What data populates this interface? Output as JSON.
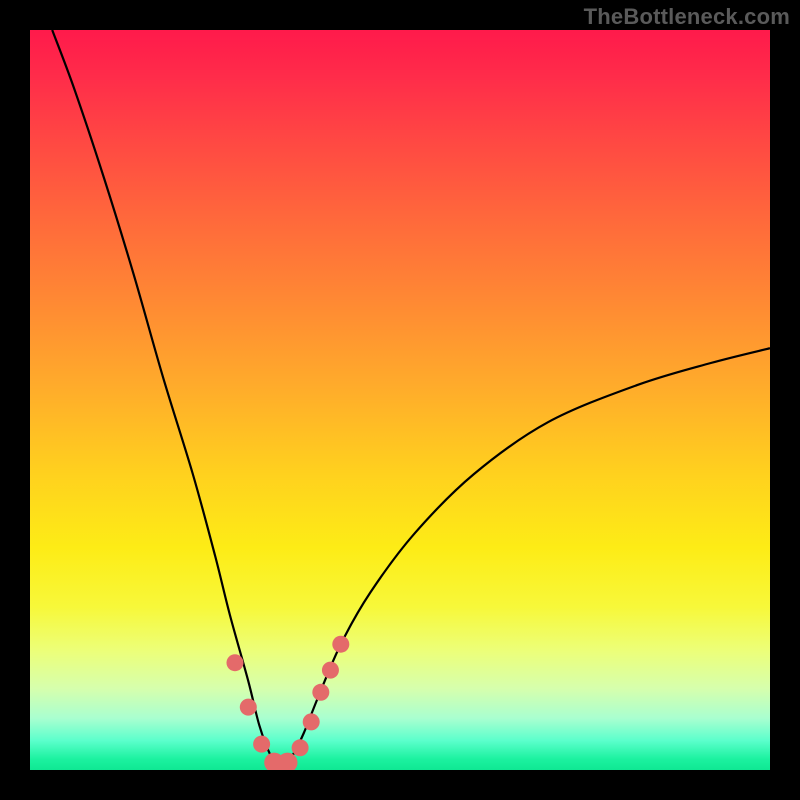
{
  "watermark": "TheBottleneck.com",
  "colors": {
    "background": "#000000",
    "curve": "#000000",
    "marker_fill": "#e46a6a",
    "marker_stroke": "#b64b4b",
    "gradient_top": "#ff1a4b",
    "gradient_bottom": "#0fe893"
  },
  "chart_data": {
    "type": "line",
    "title": "",
    "xlabel": "",
    "ylabel": "",
    "xlim": [
      0,
      100
    ],
    "ylim": [
      0,
      100
    ],
    "grid": false,
    "legend": null,
    "note": "Values are percentages of the plot area (0 = left/bottom, 100 = right/top). The curve is a pronounced V shape with its minimum near x≈34, y≈0. The left arm rises almost to the top-left corner; the right arm rises to roughly y≈57 at the right edge. Markers cluster around the valley floor.",
    "series": [
      {
        "name": "curve",
        "x": [
          3,
          6,
          10,
          14,
          18,
          22,
          25,
          27,
          29.5,
          31,
          32.5,
          34,
          35.5,
          37,
          39,
          42,
          46,
          52,
          60,
          70,
          82,
          92,
          100
        ],
        "y": [
          100,
          92,
          80,
          67,
          53,
          40,
          29,
          21,
          12,
          6,
          2,
          0,
          2,
          5,
          10,
          17,
          24,
          32,
          40,
          47,
          52,
          55,
          57
        ]
      },
      {
        "name": "markers",
        "x": [
          27.7,
          29.5,
          31.3,
          33.0,
          34.8,
          36.5,
          38.0,
          39.3,
          40.6,
          42.0
        ],
        "y": [
          14.5,
          8.5,
          3.5,
          1.0,
          1.0,
          3.0,
          6.5,
          10.5,
          13.5,
          17.0
        ]
      }
    ]
  }
}
